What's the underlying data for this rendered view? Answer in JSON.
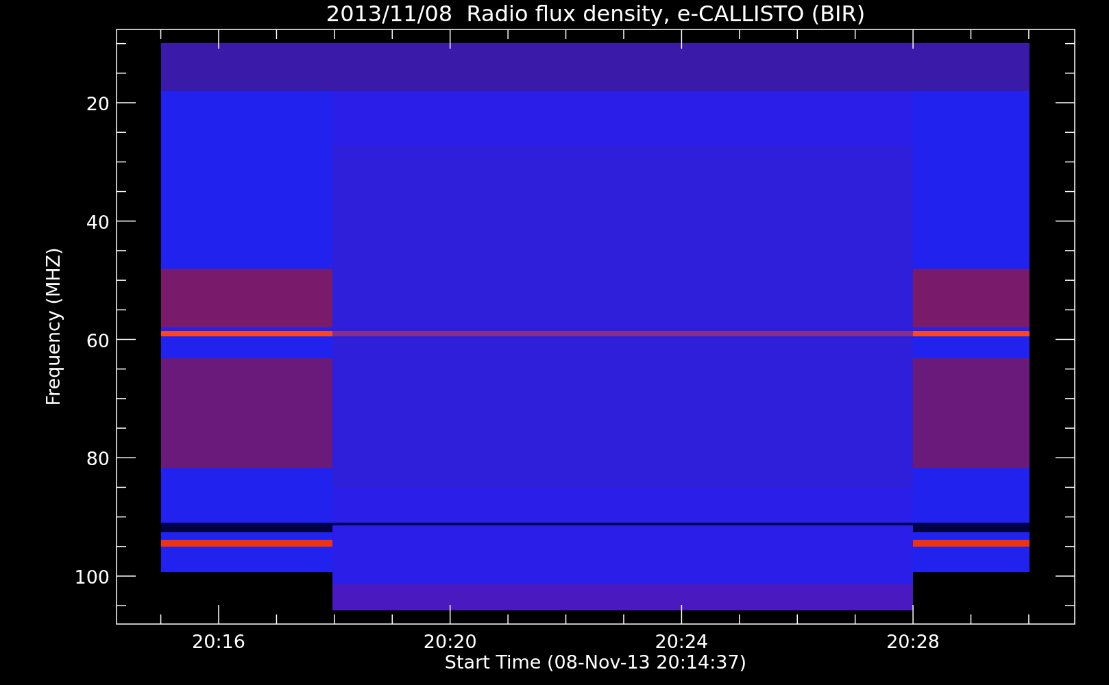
{
  "title": "2013/11/08  Radio flux density, e-CALLISTO (BIR)",
  "y_axis": {
    "label": "Frequency (MHZ)",
    "ticks": [
      "20",
      "40",
      "60",
      "80",
      "100"
    ]
  },
  "x_axis": {
    "label": "Start Time (08-Nov-13 20:14:37)",
    "ticks": [
      "20:16",
      "20:20",
      "20:24",
      "20:28"
    ]
  }
}
